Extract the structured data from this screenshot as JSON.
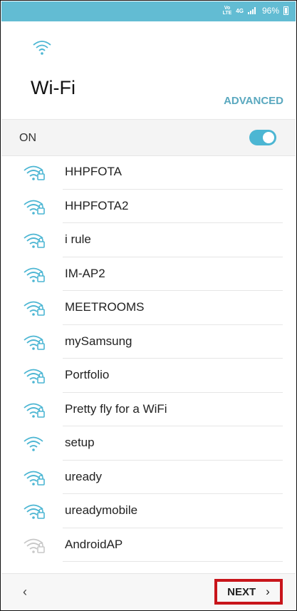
{
  "status": {
    "volte_top": "Vo",
    "volte_bottom": "LTE",
    "network": "4G",
    "battery": "96%"
  },
  "header": {
    "title": "Wi-Fi",
    "advanced_label": "ADVANCED"
  },
  "toggle": {
    "label": "ON",
    "state": "on"
  },
  "networks": [
    {
      "name": "HHPFOTA",
      "locked": true
    },
    {
      "name": "HHPFOTA2",
      "locked": true
    },
    {
      "name": "i rule",
      "locked": true
    },
    {
      "name": "IM-AP2",
      "locked": true
    },
    {
      "name": "MEETROOMS",
      "locked": true
    },
    {
      "name": "mySamsung",
      "locked": true
    },
    {
      "name": "Portfolio",
      "locked": true
    },
    {
      "name": "Pretty fly for a WiFi",
      "locked": true
    },
    {
      "name": "setup",
      "locked": false
    },
    {
      "name": "uready",
      "locked": true
    },
    {
      "name": "ureadymobile",
      "locked": true
    },
    {
      "name": "AndroidAP",
      "locked": true,
      "weak": true
    }
  ],
  "footer": {
    "back_glyph": "‹",
    "next_label": "NEXT",
    "next_glyph": "›"
  },
  "colors": {
    "accent": "#4cb6d3",
    "statusbar": "#62bcd3",
    "advanced": "#5aa8bf",
    "highlight": "#c8151b"
  }
}
